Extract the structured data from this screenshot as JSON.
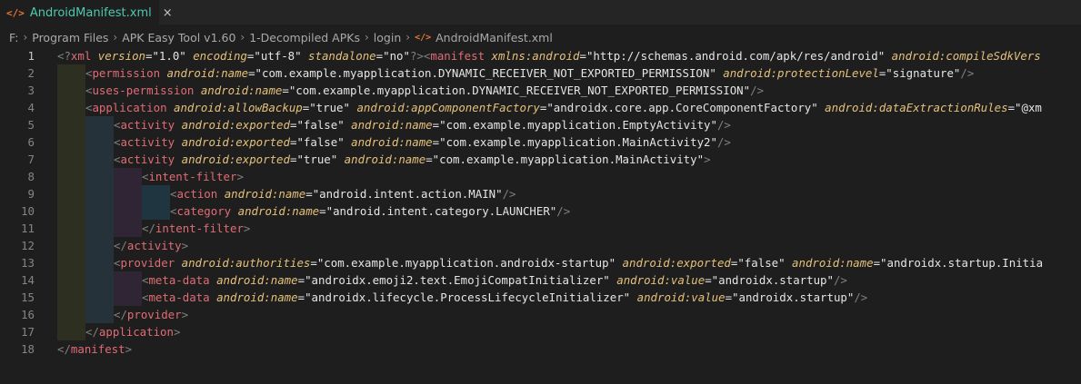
{
  "tab": {
    "icon": "xml-file-icon",
    "label": "AndroidManifest.xml",
    "close": "×"
  },
  "breadcrumb": [
    "F:",
    "Program Files",
    "APK Easy Tool v1.60",
    "1-Decompiled APKs",
    "login",
    "AndroidManifest.xml"
  ],
  "lines": [
    {
      "n": "1",
      "indent": 0,
      "code": [
        [
          "pu",
          "<?"
        ],
        [
          "pi",
          "xml"
        ],
        [
          "s",
          " "
        ],
        [
          "a",
          "version"
        ],
        [
          "s",
          "=\"1.0\" "
        ],
        [
          "a",
          "encoding"
        ],
        [
          "s",
          "=\"utf-8\" "
        ],
        [
          "a",
          "standalone"
        ],
        [
          "s",
          "=\"no\""
        ],
        [
          "pu",
          "?>"
        ],
        [
          "pu",
          "<"
        ],
        [
          "t",
          "manifest"
        ],
        [
          "s",
          " "
        ],
        [
          "a",
          "xmlns:android"
        ],
        [
          "s",
          "=\"http://schemas.android.com/apk/res/android\" "
        ],
        [
          "a",
          "android:compileSdkVers"
        ]
      ]
    },
    {
      "n": "2",
      "indent": 1,
      "code": [
        [
          "pu",
          "<"
        ],
        [
          "t",
          "permission"
        ],
        [
          "s",
          " "
        ],
        [
          "a",
          "android:name"
        ],
        [
          "s",
          "=\"com.example.myapplication.DYNAMIC_RECEIVER_NOT_EXPORTED_PERMISSION\" "
        ],
        [
          "a",
          "android:protectionLevel"
        ],
        [
          "s",
          "=\"signature\""
        ],
        [
          "pu",
          "/>"
        ]
      ]
    },
    {
      "n": "3",
      "indent": 1,
      "code": [
        [
          "pu",
          "<"
        ],
        [
          "t",
          "uses-permission"
        ],
        [
          "s",
          " "
        ],
        [
          "a",
          "android:name"
        ],
        [
          "s",
          "=\"com.example.myapplication.DYNAMIC_RECEIVER_NOT_EXPORTED_PERMISSION\""
        ],
        [
          "pu",
          "/>"
        ]
      ]
    },
    {
      "n": "4",
      "indent": 1,
      "code": [
        [
          "pu",
          "<"
        ],
        [
          "t",
          "application"
        ],
        [
          "s",
          " "
        ],
        [
          "a",
          "android:allowBackup"
        ],
        [
          "s",
          "=\"true\" "
        ],
        [
          "a",
          "android:appComponentFactory"
        ],
        [
          "s",
          "=\"androidx.core.app.CoreComponentFactory\" "
        ],
        [
          "a",
          "android:dataExtractionRules"
        ],
        [
          "s",
          "=\"@xm"
        ]
      ]
    },
    {
      "n": "5",
      "indent": 2,
      "code": [
        [
          "pu",
          "<"
        ],
        [
          "t",
          "activity"
        ],
        [
          "s",
          " "
        ],
        [
          "a",
          "android:exported"
        ],
        [
          "s",
          "=\"false\" "
        ],
        [
          "a",
          "android:name"
        ],
        [
          "s",
          "=\"com.example.myapplication.EmptyActivity\""
        ],
        [
          "pu",
          "/>"
        ]
      ]
    },
    {
      "n": "6",
      "indent": 2,
      "code": [
        [
          "pu",
          "<"
        ],
        [
          "t",
          "activity"
        ],
        [
          "s",
          " "
        ],
        [
          "a",
          "android:exported"
        ],
        [
          "s",
          "=\"false\" "
        ],
        [
          "a",
          "android:name"
        ],
        [
          "s",
          "=\"com.example.myapplication.MainActivity2\""
        ],
        [
          "pu",
          "/>"
        ]
      ]
    },
    {
      "n": "7",
      "indent": 2,
      "code": [
        [
          "pu",
          "<"
        ],
        [
          "t",
          "activity"
        ],
        [
          "s",
          " "
        ],
        [
          "a",
          "android:exported"
        ],
        [
          "s",
          "=\"true\" "
        ],
        [
          "a",
          "android:name"
        ],
        [
          "s",
          "=\"com.example.myapplication.MainActivity\""
        ],
        [
          "pu",
          ">"
        ]
      ]
    },
    {
      "n": "8",
      "indent": 3,
      "code": [
        [
          "pu",
          "<"
        ],
        [
          "t",
          "intent-filter"
        ],
        [
          "pu",
          ">"
        ]
      ]
    },
    {
      "n": "9",
      "indent": 4,
      "code": [
        [
          "pu",
          "<"
        ],
        [
          "t",
          "action"
        ],
        [
          "s",
          " "
        ],
        [
          "a",
          "android:name"
        ],
        [
          "s",
          "=\"android.intent.action.MAIN\""
        ],
        [
          "pu",
          "/>"
        ]
      ]
    },
    {
      "n": "10",
      "indent": 4,
      "code": [
        [
          "pu",
          "<"
        ],
        [
          "t",
          "category"
        ],
        [
          "s",
          " "
        ],
        [
          "a",
          "android:name"
        ],
        [
          "s",
          "=\"android.intent.category.LAUNCHER\""
        ],
        [
          "pu",
          "/>"
        ]
      ]
    },
    {
      "n": "11",
      "indent": 3,
      "code": [
        [
          "pu",
          "</"
        ],
        [
          "t",
          "intent-filter"
        ],
        [
          "pu",
          ">"
        ]
      ]
    },
    {
      "n": "12",
      "indent": 2,
      "code": [
        [
          "pu",
          "</"
        ],
        [
          "t",
          "activity"
        ],
        [
          "pu",
          ">"
        ]
      ]
    },
    {
      "n": "13",
      "indent": 2,
      "code": [
        [
          "pu",
          "<"
        ],
        [
          "t",
          "provider"
        ],
        [
          "s",
          " "
        ],
        [
          "a",
          "android:authorities"
        ],
        [
          "s",
          "=\"com.example.myapplication.androidx-startup\" "
        ],
        [
          "a",
          "android:exported"
        ],
        [
          "s",
          "=\"false\" "
        ],
        [
          "a",
          "android:name"
        ],
        [
          "s",
          "=\"androidx.startup.Initia"
        ]
      ]
    },
    {
      "n": "14",
      "indent": 3,
      "code": [
        [
          "pu",
          "<"
        ],
        [
          "t",
          "meta-data"
        ],
        [
          "s",
          " "
        ],
        [
          "a",
          "android:name"
        ],
        [
          "s",
          "=\"androidx.emoji2.text.EmojiCompatInitializer\" "
        ],
        [
          "a",
          "android:value"
        ],
        [
          "s",
          "=\"androidx.startup\""
        ],
        [
          "pu",
          "/>"
        ]
      ]
    },
    {
      "n": "15",
      "indent": 3,
      "code": [
        [
          "pu",
          "<"
        ],
        [
          "t",
          "meta-data"
        ],
        [
          "s",
          " "
        ],
        [
          "a",
          "android:name"
        ],
        [
          "s",
          "=\"androidx.lifecycle.ProcessLifecycleInitializer\" "
        ],
        [
          "a",
          "android:value"
        ],
        [
          "s",
          "=\"androidx.startup\""
        ],
        [
          "pu",
          "/>"
        ]
      ]
    },
    {
      "n": "16",
      "indent": 2,
      "code": [
        [
          "pu",
          "</"
        ],
        [
          "t",
          "provider"
        ],
        [
          "pu",
          ">"
        ]
      ]
    },
    {
      "n": "17",
      "indent": 1,
      "code": [
        [
          "pu",
          "</"
        ],
        [
          "t",
          "application"
        ],
        [
          "pu",
          ">"
        ]
      ]
    },
    {
      "n": "18",
      "indent": 0,
      "code": [
        [
          "pu",
          "</"
        ],
        [
          "t",
          "manifest"
        ],
        [
          "pu",
          ">"
        ]
      ]
    }
  ],
  "active_line": "1"
}
